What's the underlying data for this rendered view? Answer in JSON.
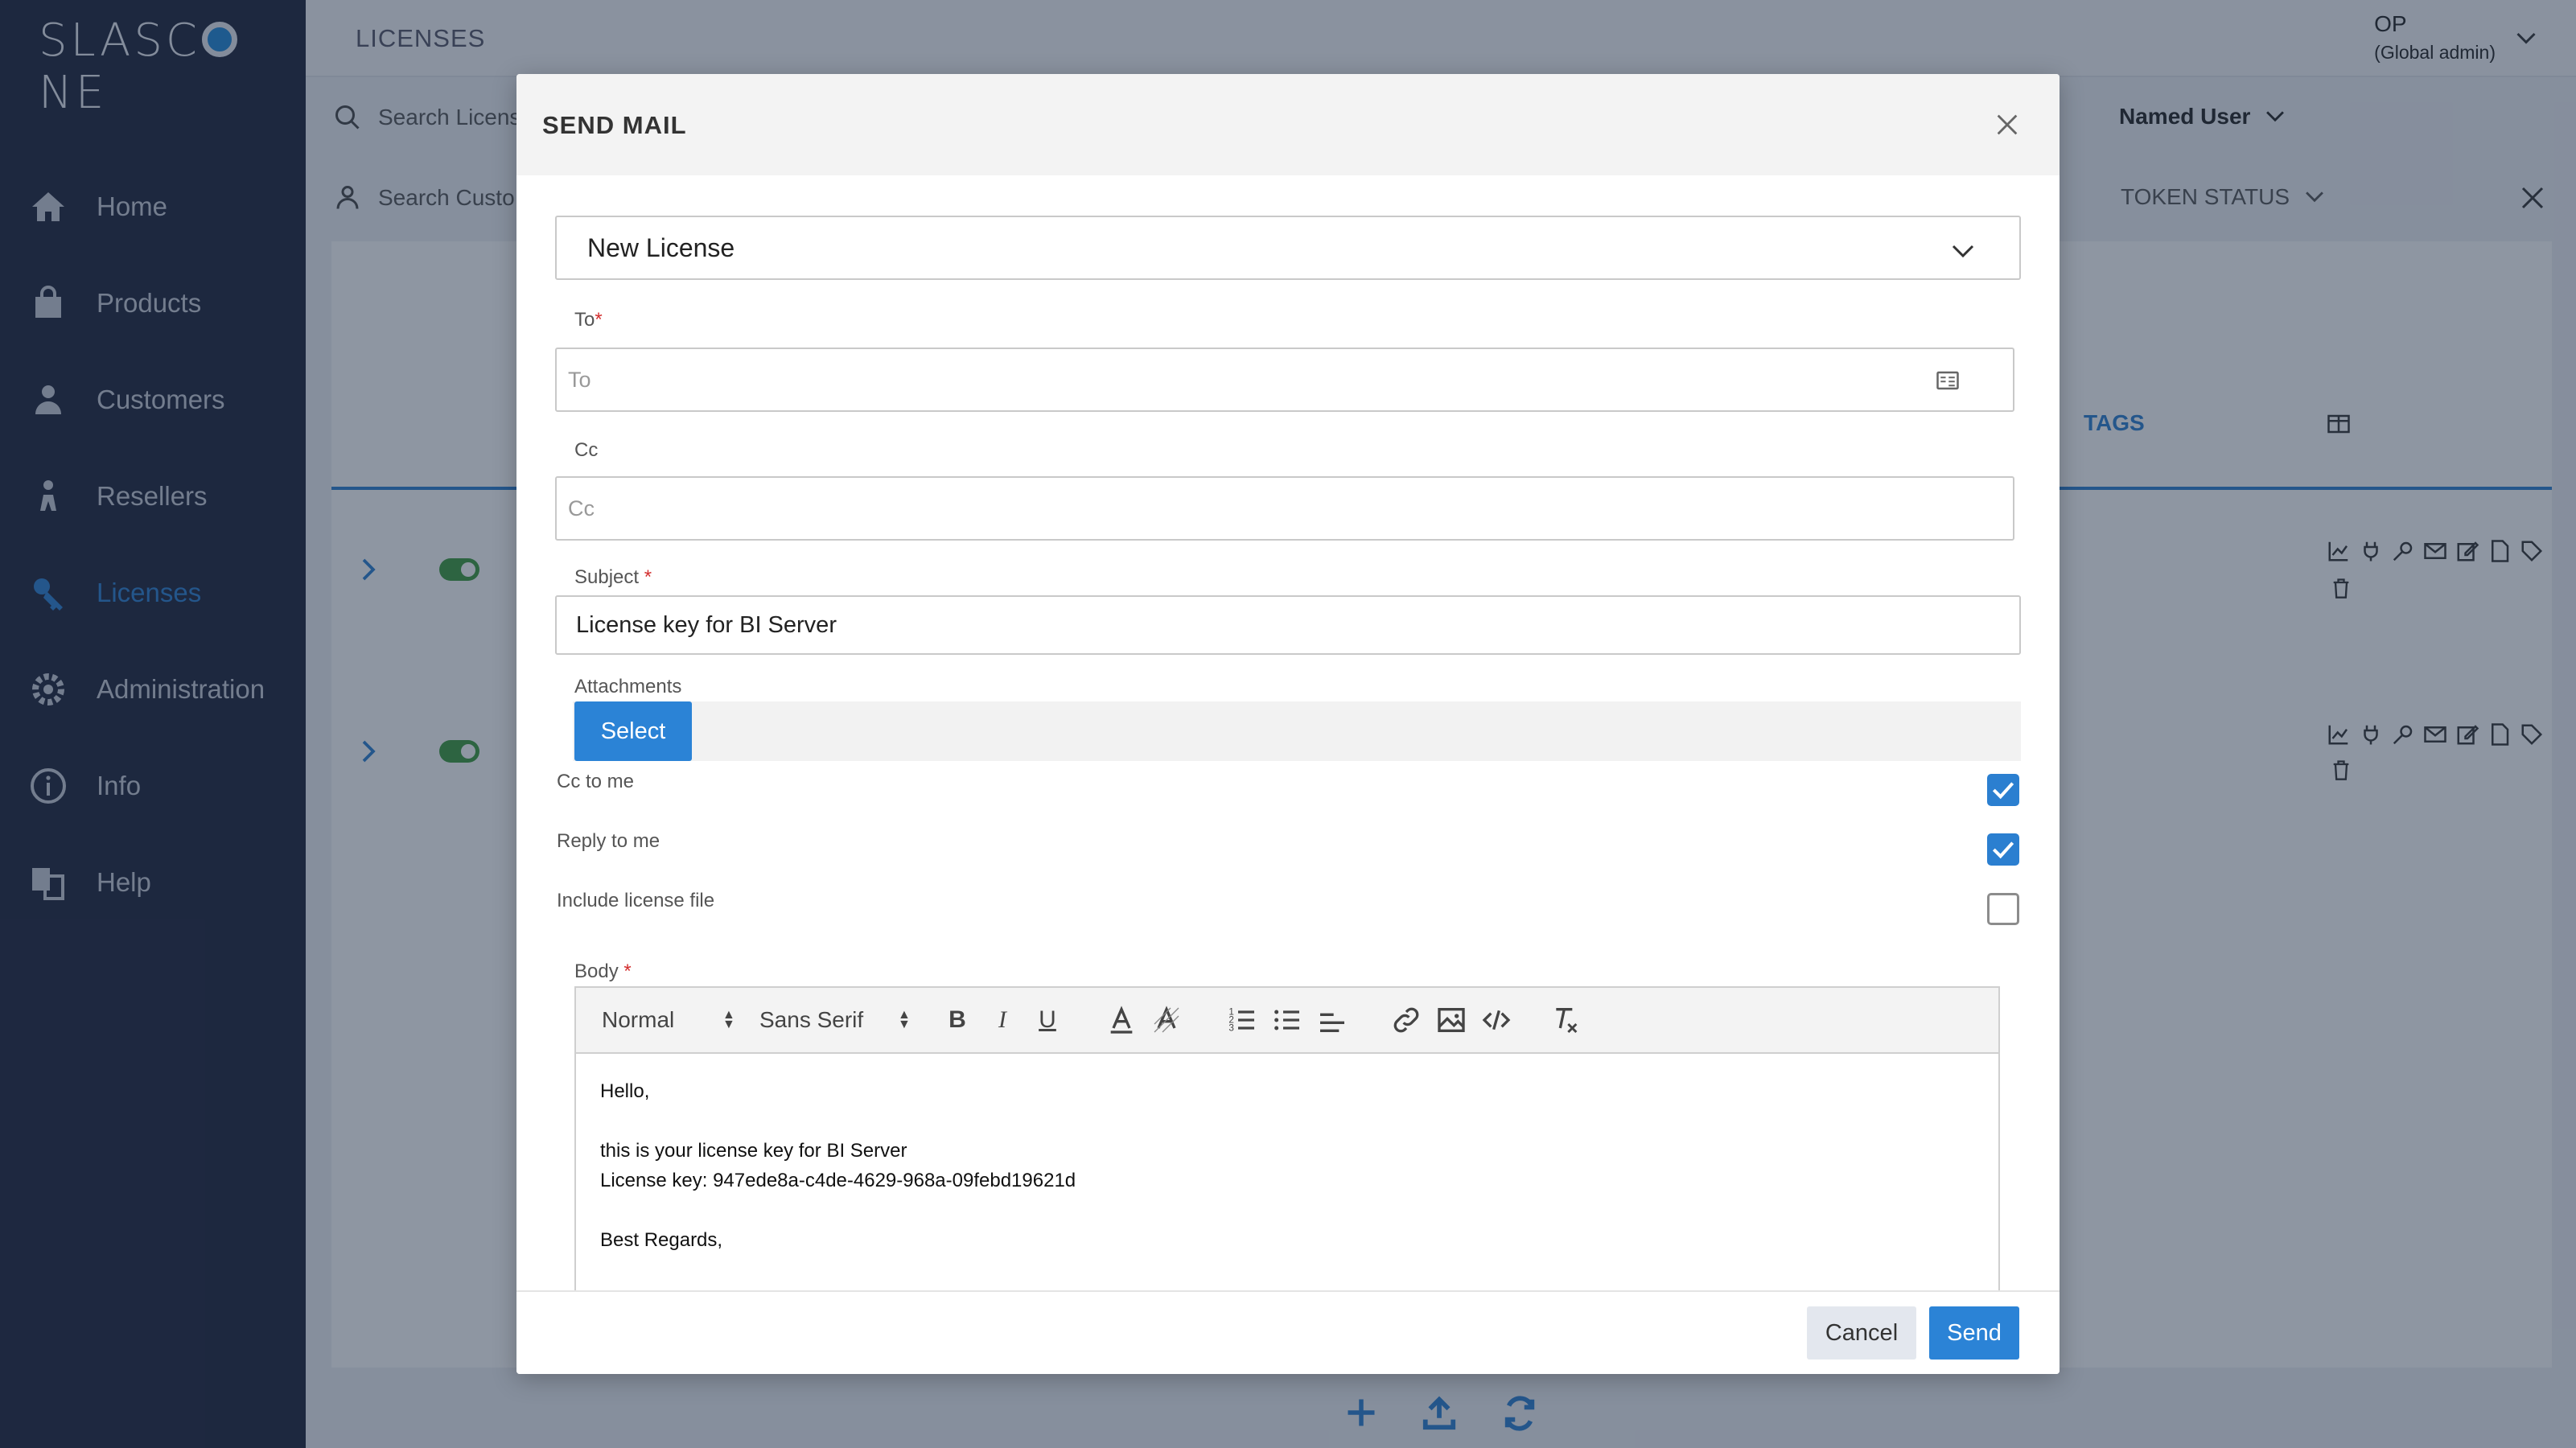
{
  "sidebar": {
    "logo": "SLASCONE",
    "items": [
      {
        "label": "Home",
        "icon": "home-icon"
      },
      {
        "label": "Products",
        "icon": "bag-icon"
      },
      {
        "label": "Customers",
        "icon": "person-icon"
      },
      {
        "label": "Resellers",
        "icon": "reseller-icon"
      },
      {
        "label": "Licenses",
        "icon": "key-icon",
        "active": true
      },
      {
        "label": "Administration",
        "icon": "gear-icon"
      },
      {
        "label": "Info",
        "icon": "info-icon"
      },
      {
        "label": "Help",
        "icon": "help-icon"
      }
    ]
  },
  "header": {
    "page_title": "LICENSES",
    "user_initials": "OP",
    "user_role": "(Global admin)"
  },
  "filters": {
    "search_licenses": "Search Licens",
    "search_customers": "Search Custo",
    "named_user": "Named User",
    "token_status": "TOKEN STATUS"
  },
  "table": {
    "tags_header": "TAGS"
  },
  "modal": {
    "title": "SEND MAIL",
    "template": "New License",
    "to_label": "To",
    "to_placeholder": "To",
    "cc_label": "Cc",
    "cc_placeholder": "Cc",
    "subject_label": "Subject",
    "subject_value": "License key for BI Server",
    "attachments_label": "Attachments",
    "select_button": "Select",
    "cc_to_me_label": "Cc to me",
    "cc_to_me_checked": true,
    "reply_to_me_label": "Reply to me",
    "reply_to_me_checked": true,
    "include_license_file_label": "Include license file",
    "include_license_file_checked": false,
    "body_label": "Body",
    "toolbar": {
      "format": "Normal",
      "font": "Sans Serif",
      "bold": "B",
      "italic": "I",
      "underline": "U"
    },
    "body_lines": [
      "Hello,",
      "",
      "this is your license key for BI Server",
      "License key: 947ede8a-c4de-4629-968a-09febd19621d",
      "",
      "Best Regards,"
    ],
    "cancel_button": "Cancel",
    "send_button": "Send"
  },
  "colors": {
    "accent": "#2b83d6",
    "sidebar_bg": "#1d2239",
    "required": "#d32f2f",
    "toggle_on": "#3d9b3d"
  }
}
